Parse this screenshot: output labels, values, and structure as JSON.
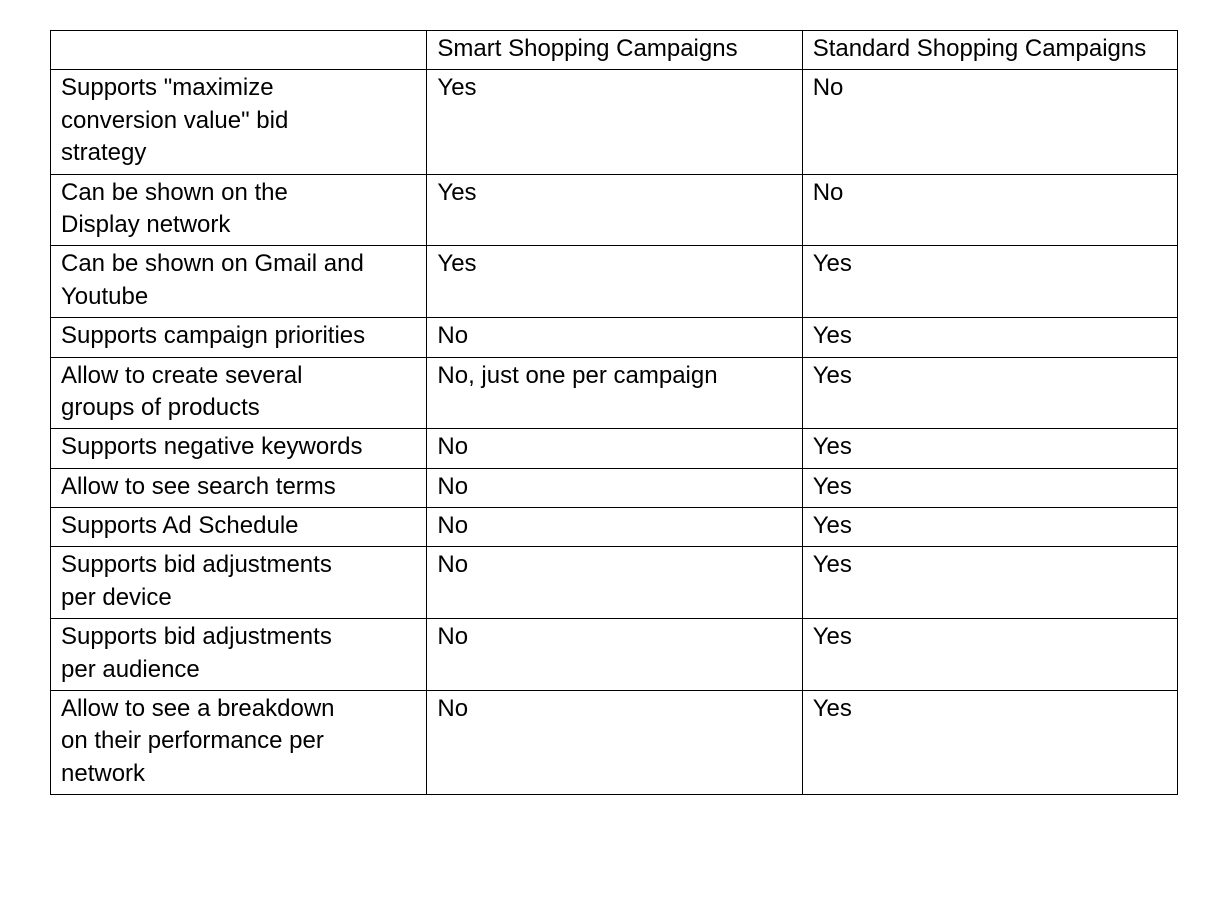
{
  "headers": {
    "blank": "",
    "smart": "Smart Shopping Campaigns",
    "standard": "Standard Shopping Campaigns"
  },
  "rows": [
    {
      "feature": "Supports \"maximize conversion value\" bid strategy",
      "smart": "Yes",
      "standard": "No"
    },
    {
      "feature": "Can be shown on the Display network",
      "smart": "Yes",
      "standard": "No"
    },
    {
      "feature": "Can be shown on Gmail and Youtube",
      "smart": "Yes",
      "standard": "Yes"
    },
    {
      "feature": "Supports campaign priorities",
      "smart": "No",
      "standard": "Yes"
    },
    {
      "feature": "Allow to create several groups of products",
      "smart": "No, just one per campaign",
      "standard": "Yes"
    },
    {
      "feature": "Supports negative keywords",
      "smart": "No",
      "standard": "Yes"
    },
    {
      "feature": "Allow to see search terms",
      "smart": "No",
      "standard": "Yes"
    },
    {
      "feature": "Supports Ad Schedule",
      "smart": "No",
      "standard": "Yes"
    },
    {
      "feature": "Supports bid adjustments per device",
      "smart": "No",
      "standard": "Yes"
    },
    {
      "feature": "Supports bid adjustments per audience",
      "smart": "No",
      "standard": "Yes"
    },
    {
      "feature": "Allow to see a breakdown on their performance per network",
      "smart": "No",
      "standard": "Yes"
    }
  ]
}
